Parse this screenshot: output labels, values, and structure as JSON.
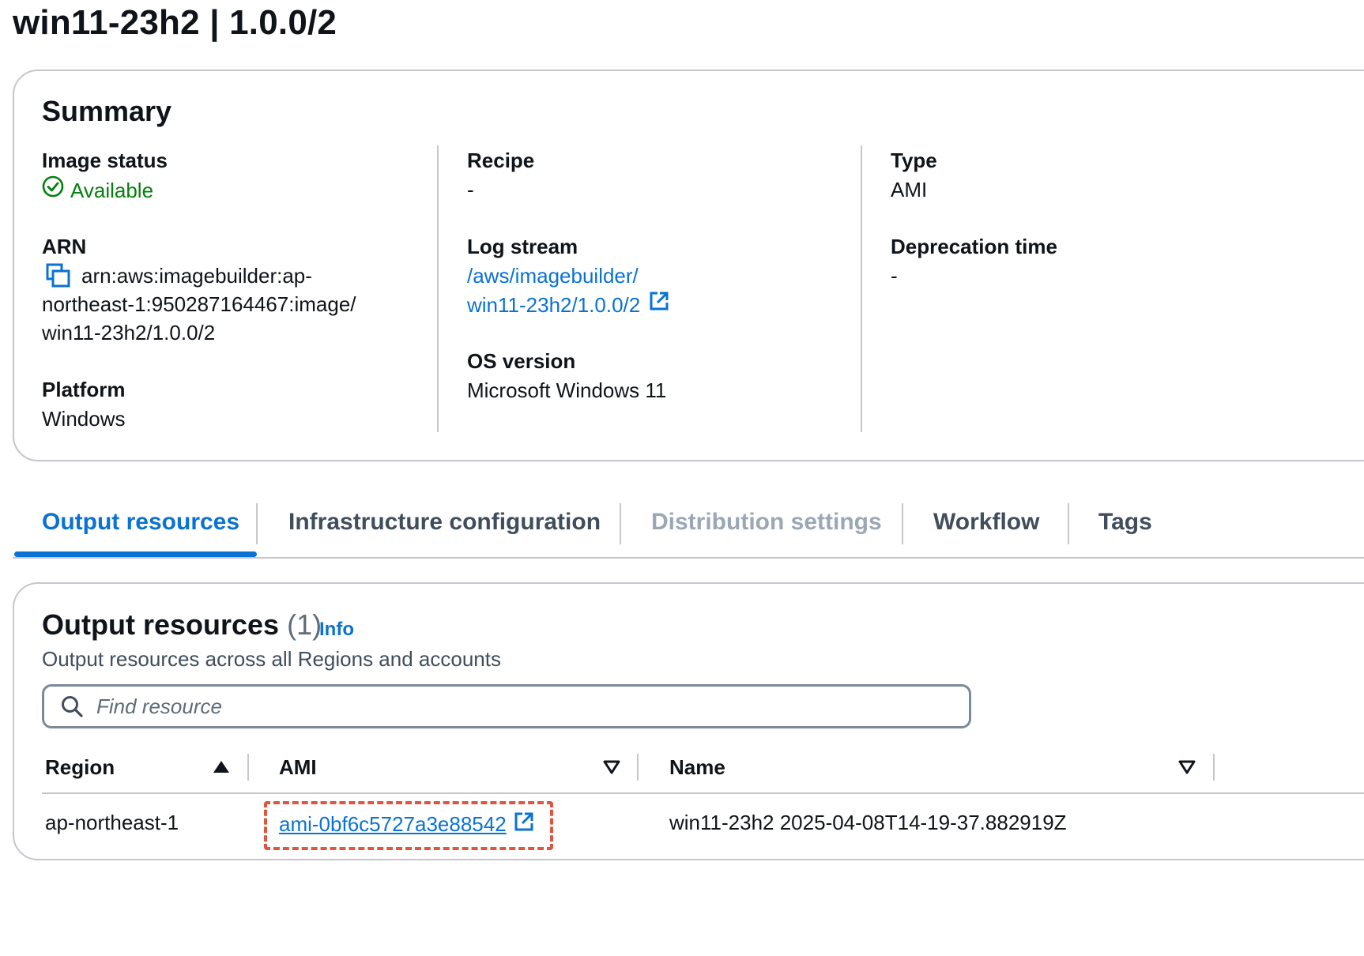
{
  "page": {
    "title": "win11-23h2 | 1.0.0/2"
  },
  "summary": {
    "title": "Summary",
    "image_status": {
      "label": "Image status",
      "value": "Available"
    },
    "arn": {
      "label": "ARN",
      "line1": "arn:aws:imagebuilder:ap-",
      "line2": "northeast-1:950287164467:image/",
      "line3": "win11-23h2/1.0.0/2"
    },
    "platform": {
      "label": "Platform",
      "value": "Windows"
    },
    "recipe": {
      "label": "Recipe",
      "value": "-"
    },
    "log_stream": {
      "label": "Log stream",
      "line1": "/aws/imagebuilder/",
      "line2": "win11-23h2/1.0.0/2"
    },
    "os_version": {
      "label": "OS version",
      "value": "Microsoft Windows 11"
    },
    "type": {
      "label": "Type",
      "value": "AMI"
    },
    "deprecation_time": {
      "label": "Deprecation time",
      "value": "-"
    }
  },
  "tabs": [
    {
      "label": "Output resources",
      "state": "active"
    },
    {
      "label": "Infrastructure configuration",
      "state": "normal"
    },
    {
      "label": "Distribution settings",
      "state": "disabled"
    },
    {
      "label": "Workflow",
      "state": "normal"
    },
    {
      "label": "Tags",
      "state": "normal"
    }
  ],
  "output": {
    "title": "Output resources",
    "count": "(1)",
    "info": "Info",
    "description": "Output resources across all Regions and accounts",
    "search_placeholder": "Find resource",
    "columns": [
      "Region",
      "AMI",
      "Name"
    ],
    "rows": [
      {
        "region": "ap-northeast-1",
        "ami": "ami-0bf6c5727a3e88542",
        "name": "win11-23h2 2025-04-08T14-19-37.882919Z"
      }
    ]
  },
  "colors": {
    "link": "#0972d3",
    "success": "#037f0c",
    "highlight": "#e0553f",
    "border": "#c6c6cd"
  }
}
